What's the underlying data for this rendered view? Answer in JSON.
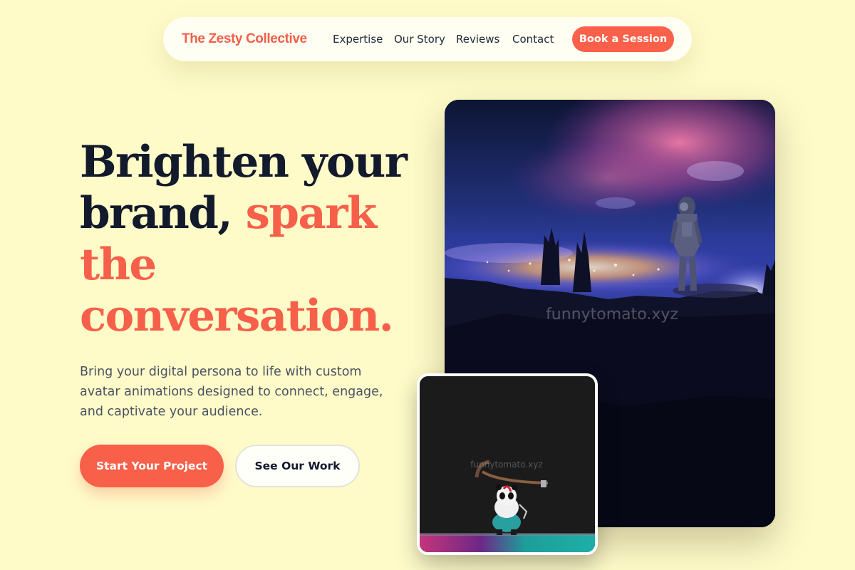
{
  "nav": {
    "brand": "The Zesty Collective",
    "links": [
      {
        "label": "Expertise"
      },
      {
        "label": "Our Story"
      },
      {
        "label": "Reviews"
      },
      {
        "label": "Contact"
      }
    ],
    "cta": "Book a Session"
  },
  "hero": {
    "title_line1": "Brighten your",
    "title_line2_plain": "brand, ",
    "title_line2_accent": "spark",
    "title_line3": "the",
    "title_line4": "conversation.",
    "subtitle_lines": [
      "Bring your digital persona to life with custom",
      "avatar animations designed to connect, engage,",
      "and captivate your audience."
    ],
    "primary_button": "Start Your Project",
    "secondary_button": "See Our Work"
  },
  "images": {
    "main_watermark": "funnytomato.xyz",
    "small_watermark": "funnytomato.xyz"
  },
  "colors": {
    "background": "#fefbc9",
    "accent": "#f8604a",
    "heading": "#131a2c",
    "body_text": "#4a5262"
  }
}
